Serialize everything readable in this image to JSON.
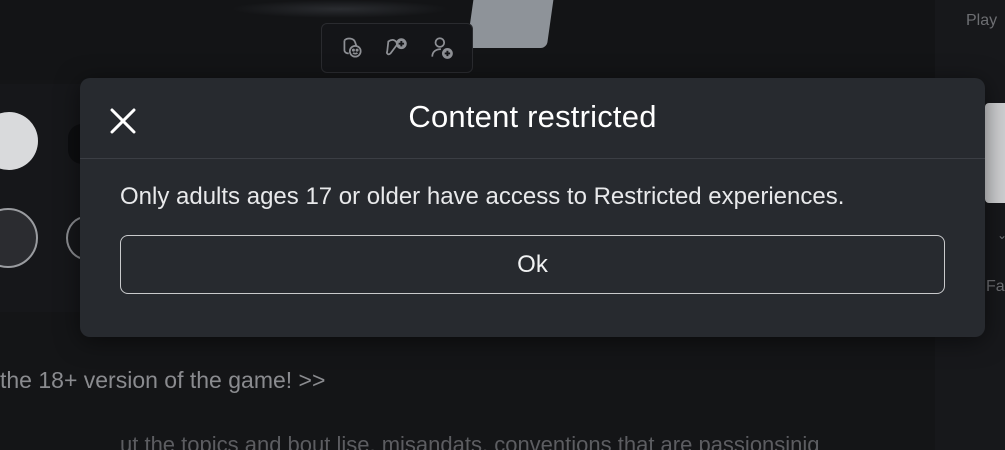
{
  "background": {
    "right_panel_label_top": "Play",
    "right_panel_label_bottom": "Fa",
    "promo_link": "the 18+ version of the game! >>",
    "trailing_text": "ut the topics and bout lise, misandats, conventions that are passionsinig"
  },
  "avatar_actions": {
    "icons": [
      "emote-icon",
      "add-friend-icon",
      "follow-icon"
    ]
  },
  "modal": {
    "title": "Content restricted",
    "message": "Only adults ages 17 or older have access to Restricted experiences.",
    "ok_label": "Ok"
  },
  "colors": {
    "modal_bg": "#272a2f",
    "page_bg": "#141517",
    "text": "#ffffff",
    "button_border": "#c9cacc"
  }
}
